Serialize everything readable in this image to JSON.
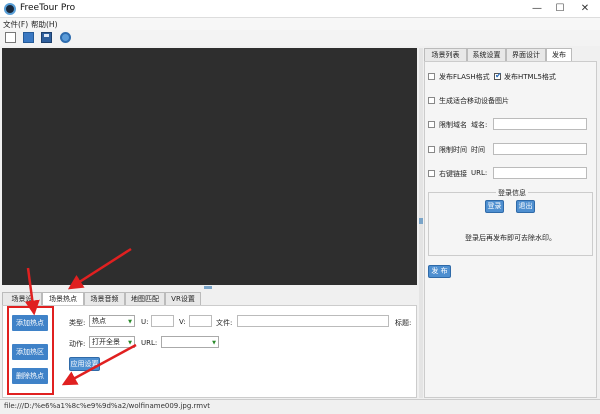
{
  "window": {
    "title": "FreeTour Pro",
    "minimize": "—",
    "maximize": "☐",
    "close": "✕"
  },
  "menu": [
    "文件(F)",
    "帮助(H)"
  ],
  "toolbar": [
    "new-file-icon",
    "open-folder-icon",
    "save-icon",
    "settings-icon"
  ],
  "right_tabs": [
    "场景列表",
    "系统设置",
    "界面设计",
    "发布"
  ],
  "publish": {
    "flash_label": "发布FLASH格式",
    "html5_label": "发布HTML5格式",
    "mobile_label": "生成适合移动设备图片",
    "domain_limit_label": "限制域名",
    "domain_field_label": "域名:",
    "time_limit_label": "限制时间",
    "time_field_label": "时间",
    "right_click_label": "右键链接",
    "url_field_label": "URL:",
    "login_group_title": "登录信息",
    "login_button": "登录",
    "logout_button": "退出",
    "login_hint": "登录后再发布即可去除水印。",
    "publish_button": "发 布"
  },
  "bottom_tabs": [
    "场景设",
    "场景热点",
    "场景音频",
    "地图匹配",
    "VR设置"
  ],
  "hotspot": {
    "side_buttons": [
      "添加热点",
      "添加热区",
      "删除热点"
    ],
    "type_label": "类型:",
    "type_value": "热点",
    "u_label": "U:",
    "v_label": "V:",
    "file_label": "文件:",
    "tag_label": "标题:",
    "action_label": "动作:",
    "action_value": "打开全景",
    "url_label": "URL:",
    "apply_button": "应用设置"
  },
  "status": "file:///D:/%e6%a1%8c%e9%9d%a2/wolfiname009.jpg.rmvt",
  "colors": {
    "accent": "#4e8fd0",
    "annotation": "#e02020",
    "canvas": "#2e2e2e"
  }
}
